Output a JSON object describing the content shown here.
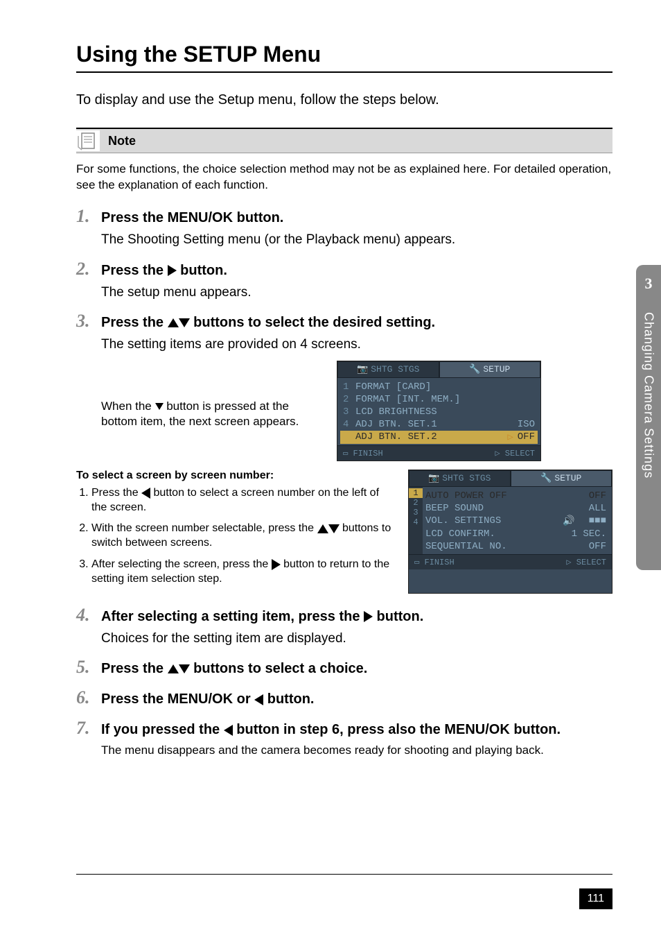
{
  "title": "Using the SETUP Menu",
  "intro": "To display and use the Setup menu, follow the steps below.",
  "note": {
    "label": "Note",
    "body": "For some functions, the choice selection method may not be as explained here. For detailed operation, see the explanation of each function."
  },
  "steps": {
    "s1": {
      "num": "1.",
      "title_pre": "Press the ",
      "title_btn": "MENU/OK",
      "title_post": " button.",
      "body": "The Shooting Setting menu (or the Playback menu) appears."
    },
    "s2": {
      "num": "2.",
      "title_pre": "Press the ",
      "title_post": " button.",
      "body": "The setup menu appears."
    },
    "s3": {
      "num": "3.",
      "title_pre": "Press the ",
      "title_post": " buttons to select the desired setting.",
      "body": "The setting items are provided on 4 screens.",
      "when_pre": "When the ",
      "when_post": " button is pressed at the bottom item, the next screen appears."
    },
    "s4": {
      "num": "4.",
      "title_pre": "After selecting a setting item, press the ",
      "title_post": " button.",
      "body": "Choices for the setting item are displayed."
    },
    "s5": {
      "num": "5.",
      "title_pre": "Press the ",
      "title_post": " buttons to select a choice."
    },
    "s6": {
      "num": "6.",
      "title_pre": "Press the ",
      "title_mid": "MENU/OK",
      "title_or": " or ",
      "title_post": " button."
    },
    "s7": {
      "num": "7.",
      "title_pre": "If you pressed the ",
      "title_mid": " button in step 6, press also the ",
      "title_btn": "MENU/OK",
      "title_post": " button.",
      "body": "The menu disappears and the camera becomes ready for shooting and playing back."
    }
  },
  "screen_by_number": {
    "title": "To select a screen by screen number:",
    "li1_pre": "Press the ",
    "li1_post": " button to select a screen number on the left of the screen.",
    "li2_pre": "With the screen number selectable, press the ",
    "li2_post": " buttons to switch between screens.",
    "li3_pre": "After selecting the screen, press the ",
    "li3_post": " button to return to the setting item selection step."
  },
  "lcd1": {
    "tab_inactive": "SHTG STGS",
    "tab_active": "SETUP",
    "rows": [
      {
        "n": "1",
        "label": "FORMAT  [CARD]",
        "val": ""
      },
      {
        "n": "2",
        "label": "FORMAT  [INT. MEM.]",
        "val": ""
      },
      {
        "n": "3",
        "label": "LCD BRIGHTNESS",
        "val": ""
      },
      {
        "n": "4",
        "label": "ADJ BTN. SET.1",
        "val": "ISO"
      },
      {
        "n": "",
        "label": "ADJ BTN. SET.2",
        "val": "OFF",
        "hl": true
      }
    ],
    "footer_left": "FINISH",
    "footer_right": "SELECT"
  },
  "lcd2": {
    "tab_inactive": "SHTG STGS",
    "tab_active": "SETUP",
    "side": [
      "1",
      "2",
      "3",
      "4"
    ],
    "rows": [
      {
        "label": "AUTO POWER OFF",
        "val": "OFF",
        "hl": true
      },
      {
        "label": "BEEP SOUND",
        "val": "ALL"
      },
      {
        "label": "VOL. SETTINGS",
        "val": "■■■"
      },
      {
        "label": "LCD CONFIRM.",
        "val": "1 SEC."
      },
      {
        "label": "SEQUENTIAL NO.",
        "val": "OFF"
      }
    ],
    "footer_left": "FINISH",
    "footer_right": "SELECT"
  },
  "side_tab": {
    "num": "3",
    "text": "Changing Camera Settings"
  },
  "page_number": "111"
}
